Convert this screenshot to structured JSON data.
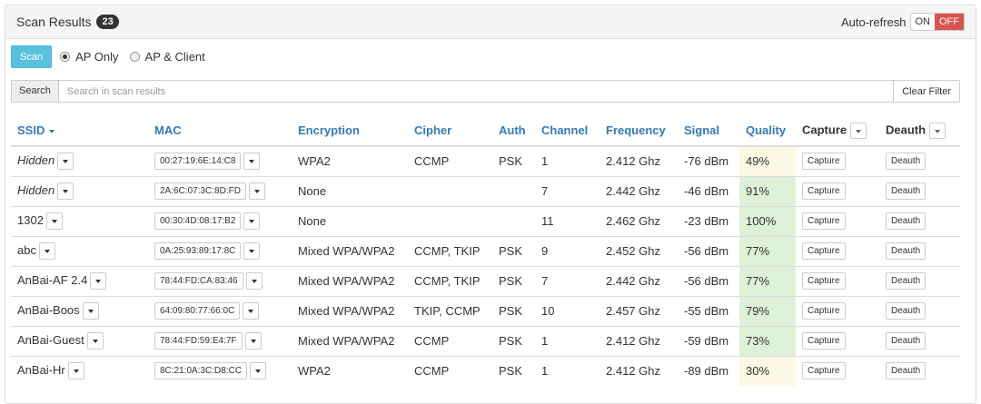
{
  "header": {
    "title": "Scan Results",
    "count": "23",
    "autorefresh_label": "Auto-refresh",
    "toggle_on": "ON",
    "toggle_off": "OFF"
  },
  "controls": {
    "scan_label": "Scan",
    "radio_ap_only": "AP Only",
    "radio_ap_client": "AP & Client",
    "selected": "AP Only"
  },
  "search": {
    "label": "Search",
    "placeholder": "Search in scan results",
    "value": "",
    "clear_label": "Clear Filter"
  },
  "table": {
    "columns": {
      "ssid": "SSID",
      "mac": "MAC",
      "encryption": "Encryption",
      "cipher": "Cipher",
      "auth": "Auth",
      "channel": "Channel",
      "frequency": "Frequency",
      "signal": "Signal",
      "quality": "Quality",
      "capture": "Capture",
      "deauth": "Deauth"
    },
    "capture_btn": "Capture",
    "deauth_btn": "Deauth",
    "rows": [
      {
        "ssid": "Hidden",
        "hidden": true,
        "mac": "00:27:19:6E:14:C8",
        "encryption": "WPA2",
        "cipher": "CCMP",
        "auth": "PSK",
        "channel": "1",
        "frequency": "2.412 Ghz",
        "signal": "-76 dBm",
        "quality": "49%"
      },
      {
        "ssid": "Hidden",
        "hidden": true,
        "mac": "2A:6C:07:3C:8D:FD",
        "encryption": "None",
        "cipher": "",
        "auth": "",
        "channel": "7",
        "frequency": "2.442 Ghz",
        "signal": "-46 dBm",
        "quality": "91%"
      },
      {
        "ssid": "1302",
        "hidden": false,
        "mac": "00:30:4D:08:17:B2",
        "encryption": "None",
        "cipher": "",
        "auth": "",
        "channel": "11",
        "frequency": "2.462 Ghz",
        "signal": "-23 dBm",
        "quality": "100%"
      },
      {
        "ssid": "abc",
        "hidden": false,
        "mac": "0A:25:93:89:17:8C",
        "encryption": "Mixed WPA/WPA2",
        "cipher": "CCMP, TKIP",
        "auth": "PSK",
        "channel": "9",
        "frequency": "2.452 Ghz",
        "signal": "-56 dBm",
        "quality": "77%"
      },
      {
        "ssid": "AnBai-AF 2.4",
        "hidden": false,
        "mac": "78:44:FD:CA:83:46",
        "encryption": "Mixed WPA/WPA2",
        "cipher": "CCMP, TKIP",
        "auth": "PSK",
        "channel": "7",
        "frequency": "2.442 Ghz",
        "signal": "-56 dBm",
        "quality": "77%"
      },
      {
        "ssid": "AnBai-Boos",
        "hidden": false,
        "mac": "64:09:80:77:66:0C",
        "encryption": "Mixed WPA/WPA2",
        "cipher": "TKIP, CCMP",
        "auth": "PSK",
        "channel": "10",
        "frequency": "2.457 Ghz",
        "signal": "-55 dBm",
        "quality": "79%"
      },
      {
        "ssid": "AnBai-Guest",
        "hidden": false,
        "mac": "78:44:FD:59:E4:7F",
        "encryption": "Mixed WPA/WPA2",
        "cipher": "CCMP",
        "auth": "PSK",
        "channel": "1",
        "frequency": "2.412 Ghz",
        "signal": "-59 dBm",
        "quality": "73%"
      },
      {
        "ssid": "AnBai-Hr",
        "hidden": false,
        "mac": "8C:21:0A:3C:D8:CC",
        "encryption": "WPA2",
        "cipher": "CCMP",
        "auth": "PSK",
        "channel": "1",
        "frequency": "2.412 Ghz",
        "signal": "-89 dBm",
        "quality": "30%"
      }
    ]
  }
}
